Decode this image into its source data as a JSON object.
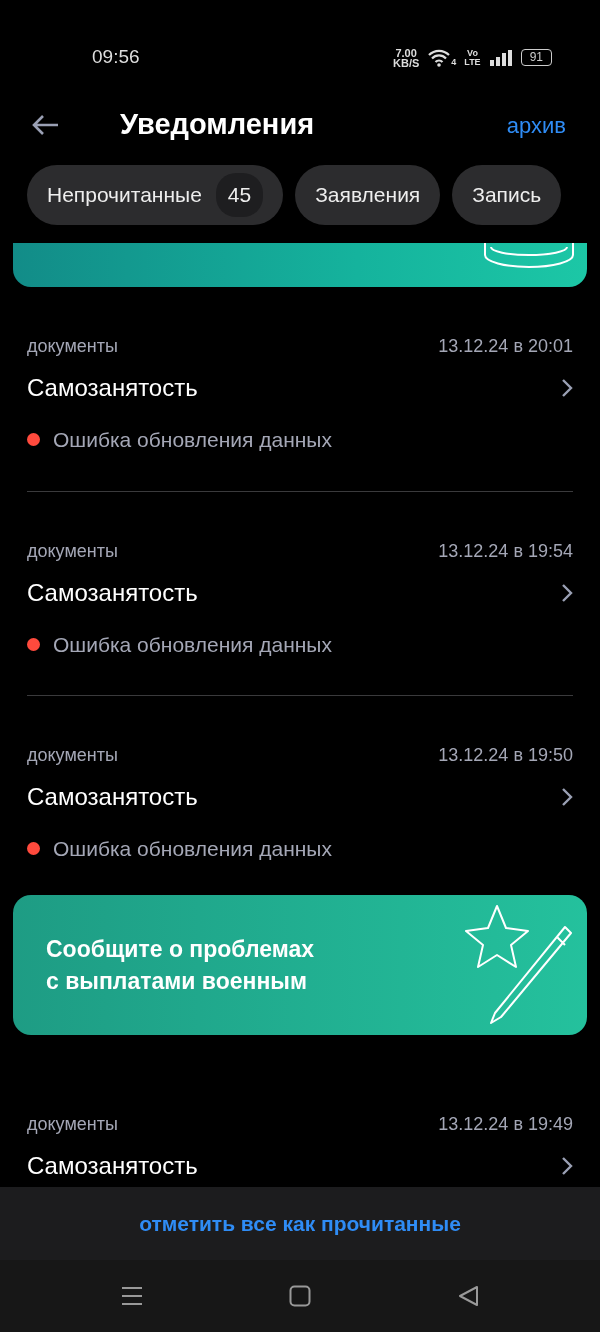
{
  "status_bar": {
    "time": "09:56",
    "speed_value": "7.00",
    "speed_unit": "KB/S",
    "wifi_label": "4",
    "volte_top": "Vo",
    "volte_bottom": "LTE",
    "battery": "91"
  },
  "header": {
    "title": "Уведомления",
    "action": "архив"
  },
  "chips": [
    {
      "label": "Непрочитанные",
      "count": "45"
    },
    {
      "label": "Заявления"
    },
    {
      "label": "Запись"
    }
  ],
  "feed": [
    {
      "kind": "banner_partial"
    },
    {
      "kind": "notification",
      "category": "документы",
      "date": "13.12.24 в 20:01",
      "title": "Самозанятость",
      "status": "Ошибка обновления данных",
      "color": "#ff4a3d"
    },
    {
      "kind": "notification",
      "category": "документы",
      "date": "13.12.24 в 19:54",
      "title": "Самозанятость",
      "status": "Ошибка обновления данных",
      "color": "#ff4a3d"
    },
    {
      "kind": "notification",
      "category": "документы",
      "date": "13.12.24 в 19:50",
      "title": "Самозанятость",
      "status": "Ошибка обновления данных",
      "color": "#ff4a3d"
    },
    {
      "kind": "banner",
      "text": "Сообщите о проблемах\nс выплатами военным"
    },
    {
      "kind": "notification",
      "category": "документы",
      "date": "13.12.24 в 19:49",
      "title": "Самозанятость"
    }
  ],
  "bottom_action": "отметить все как прочитанные"
}
